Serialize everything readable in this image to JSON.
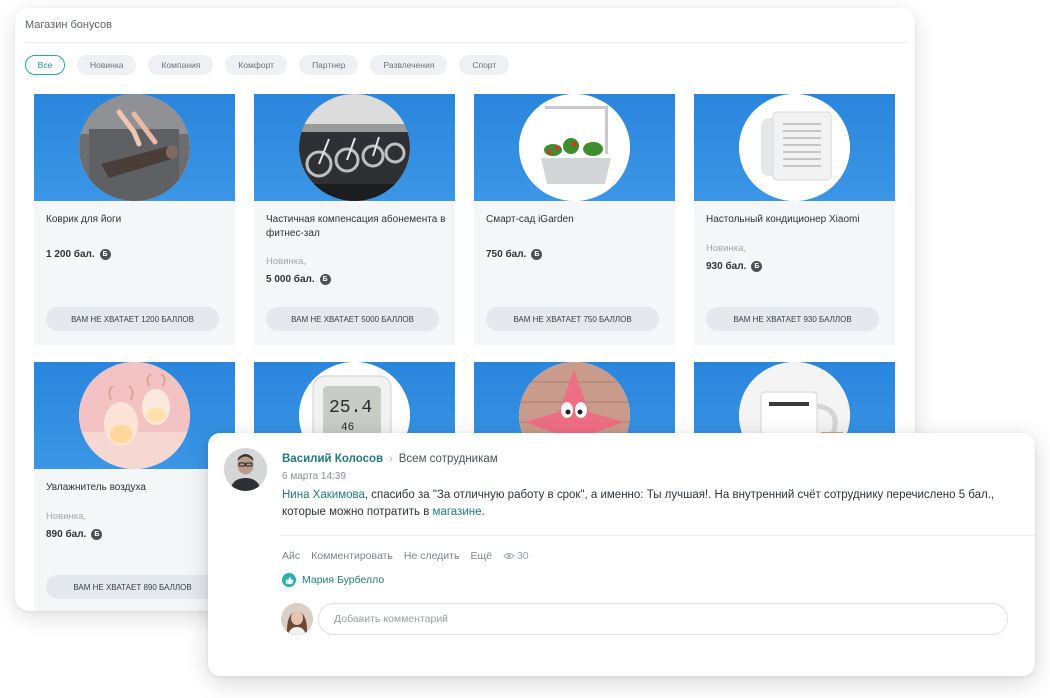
{
  "shop": {
    "title": "Магазин бонусов",
    "filters": [
      "Все",
      "Новинка",
      "Компания",
      "Комфорт",
      "Партнер",
      "Развлечения",
      "Спорт"
    ],
    "active_filter": "Все",
    "products": [
      {
        "name": "Коврик для йоги",
        "tag": "",
        "price": "1 200 бал.",
        "button": "ВАМ НЕ ХВАТАЕТ 1200 БАЛЛОВ",
        "icon": "yoga-mat-icon"
      },
      {
        "name": "Частичная компенсация абонемента в фитнес-зал",
        "tag": "Новинка,",
        "price": "5 000 бал.",
        "button": "ВАМ НЕ ХВАТАЕТ 5000 БАЛЛОВ",
        "icon": "gym-icon"
      },
      {
        "name": "Смарт-сад iGarden",
        "tag": "",
        "price": "750 бал.",
        "button": "ВАМ НЕ ХВАТАЕТ 750 БАЛЛОВ",
        "icon": "smart-garden-icon"
      },
      {
        "name": "Настольный кондиционер Xiaomi",
        "tag": "Новинка,",
        "price": "930 бал.",
        "button": "ВАМ НЕ ХВАТАЕТ 930 БАЛЛОВ",
        "icon": "air-conditioner-icon"
      },
      {
        "name": "Увлажнитель воздуха",
        "tag": "Новинка,",
        "price": "890 бал.",
        "button": "ВАМ НЕ ХВАТАЕТ 890 БАЛЛОВ",
        "icon": "humidifier-icon"
      },
      {
        "name": "",
        "tag": "",
        "price": "",
        "button": "",
        "icon": "thermometer-icon"
      },
      {
        "name": "",
        "tag": "",
        "price": "",
        "button": "",
        "icon": "starfish-toy-icon"
      },
      {
        "name": "",
        "tag": "",
        "price": "",
        "button": "",
        "icon": "mug-icon"
      }
    ],
    "coin_symbol": "Б"
  },
  "post": {
    "author": "Василий Колосов",
    "audience": "Всем сотрудникам",
    "date": "6 марта 14:39",
    "recipient": "Нина Хакимова",
    "text_main": ", спасибо за \"За отличную работу в срок\", а именно: Ты лучшая!. На внутренний счёт сотруднику перечислено 5 бал., которые можно потратить в ",
    "shop_link": "магазине",
    "text_end": ".",
    "actions": [
      "Айс",
      "Комментировать",
      "Не следить",
      "Ещё"
    ],
    "views": "30",
    "liked_by": "Мария Бурбелло",
    "comment_placeholder": "Добавить комментарий"
  },
  "colors": {
    "accent": "#237a76",
    "banner_blue": "#2a86dc",
    "like": "#28b2a9"
  }
}
